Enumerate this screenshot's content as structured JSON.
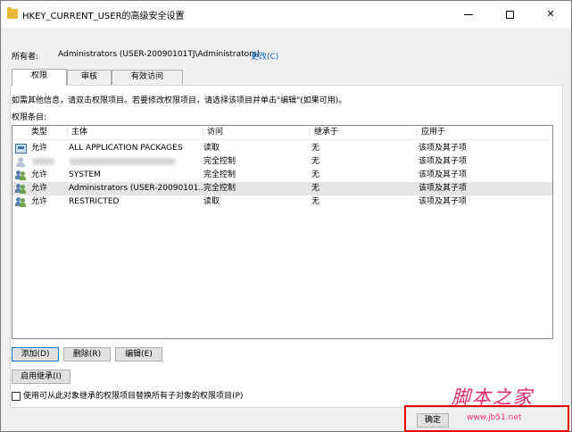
{
  "window": {
    "title": "HKEY_CURRENT_USER的高级安全设置",
    "minimize_glyph": "",
    "close_glyph": "✕"
  },
  "owner": {
    "label": "所有者:",
    "value": "Administrators (USER-20090101TJ\\Administrators)",
    "change_link": "更改(C)"
  },
  "tabs": [
    {
      "label": "权限",
      "active": true
    },
    {
      "label": "审核",
      "active": false
    },
    {
      "label": "有效访问",
      "active": false
    }
  ],
  "info_text": "如需其他信息，请双击权限项目。若要修改权限项目，请选择该项目并单击\"编辑\"(如果可用)。",
  "entries_label": "权限条目:",
  "table": {
    "headers": [
      "类型",
      "主体",
      "访问",
      "继承于",
      "应用于"
    ],
    "rows": [
      {
        "icon": "package-icon",
        "type": "允许",
        "principal": "ALL APPLICATION PACKAGES",
        "access": "读取",
        "inherit": "无",
        "apply": "该项及其子项"
      },
      {
        "icon": "user-icon",
        "type": "",
        "principal": "",
        "access": "完全控制",
        "inherit": "无",
        "apply": "该项及其子项"
      },
      {
        "icon": "users-icon",
        "type": "允许",
        "principal": "SYSTEM",
        "access": "完全控制",
        "inherit": "无",
        "apply": "该项及其子项"
      },
      {
        "icon": "users-icon",
        "type": "允许",
        "principal": "Administrators (USER-20090101...",
        "access": "完全控制",
        "inherit": "无",
        "apply": "该项及其子项"
      },
      {
        "icon": "users-icon",
        "type": "允许",
        "principal": "RESTRICTED",
        "access": "读取",
        "inherit": "无",
        "apply": "该项及其子项"
      }
    ]
  },
  "buttons": {
    "add": "添加(D)",
    "remove": "删除(R)",
    "edit": "编辑(E)",
    "enable_inheritance": "启用继承(I)",
    "ok": "确定"
  },
  "checkbox": {
    "label": "使用可从此对象继承的权限项目替换所有子对象的权限项目(P)",
    "checked": false
  },
  "watermark": {
    "big": "脚本之家",
    "small": "www.jb51.net"
  }
}
